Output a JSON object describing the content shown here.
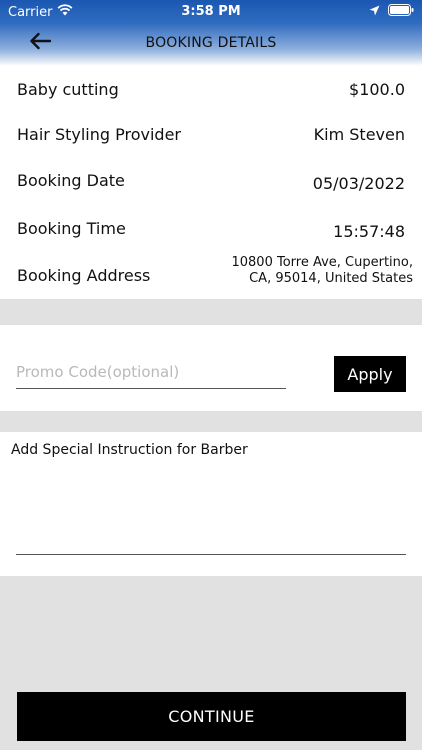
{
  "status_bar": {
    "carrier": "Carrier",
    "time": "3:58 PM"
  },
  "header": {
    "title": "BOOKING DETAILS",
    "back_icon": "arrow-left-icon"
  },
  "details": {
    "service": {
      "label": "Baby cutting",
      "value": "$100.0"
    },
    "provider": {
      "label": "Hair Styling Provider",
      "value": "Kim Steven"
    },
    "date": {
      "label": "Booking Date",
      "value": "05/03/2022"
    },
    "time": {
      "label": "Booking Time",
      "value": "15:57:48"
    },
    "address": {
      "label": "Booking Address",
      "value_line1": "10800 Torre Ave, Cupertino,",
      "value_line2": "CA, 95014, United States"
    }
  },
  "promo": {
    "placeholder": "Promo Code(optional)",
    "value": "",
    "apply_label": "Apply"
  },
  "instructions": {
    "label": "Add Special Instruction for Barber",
    "value": ""
  },
  "footer": {
    "continue_label": "CONTINUE"
  }
}
